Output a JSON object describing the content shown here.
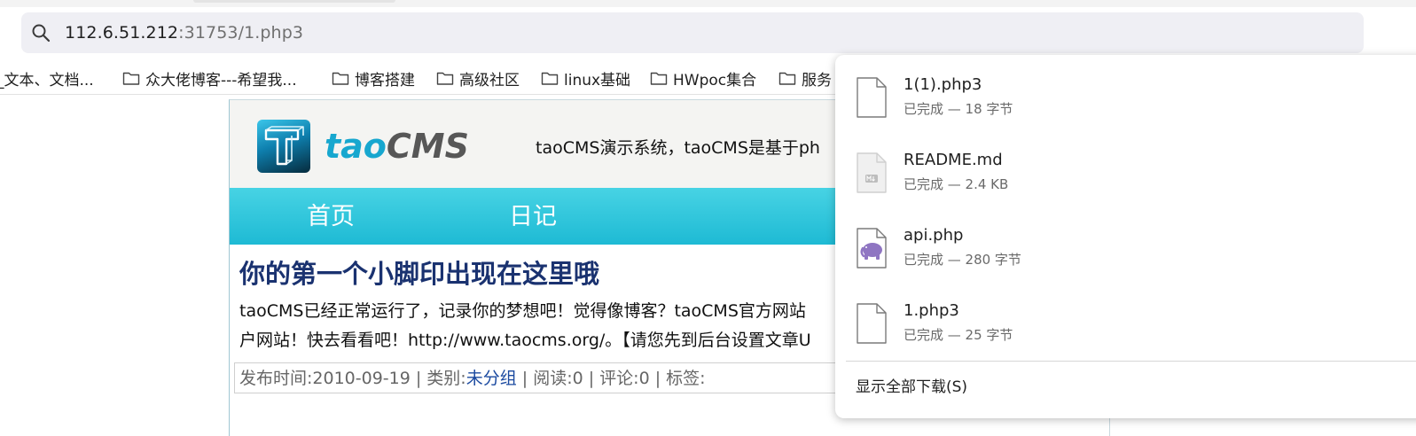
{
  "browser": {
    "address_host": "112.6.51.212",
    "address_rest": ":31753/1.php3"
  },
  "bookmarks": [
    {
      "label": "_文本、文档..."
    },
    {
      "label": "众大佬博客---希望我..."
    },
    {
      "label": "博客搭建"
    },
    {
      "label": "高级社区"
    },
    {
      "label": "linux基础"
    },
    {
      "label": "HWpoc集合"
    },
    {
      "label": "服务"
    }
  ],
  "site": {
    "logo_tao": "tao",
    "logo_cms": "CMS",
    "slogan": "taoCMS演示系统，taoCMS是基于ph",
    "nav": [
      "首页",
      "日记"
    ]
  },
  "post": {
    "title": "你的第一个小脚印出现在这里哦",
    "body_line1": "taoCMS已经正常运行了，记录你的梦想吧！觉得像博客？taoCMS官方网站",
    "body_line2": "户网站！快去看看吧！http://www.taocms.org/。【请您先到后台设置文章U",
    "meta_pre": "发布时间:2010-09-19 | 类别:",
    "meta_category": "未分组",
    "meta_post": " | 阅读:0 | 评论:0 | 标签:"
  },
  "downloads": {
    "items": [
      {
        "name": "1(1).php3",
        "status": "已完成 — 18 字节",
        "icon": "file-icon"
      },
      {
        "name": "README.md",
        "status": "已完成 — 2.4 KB",
        "icon": "markdown-file-icon"
      },
      {
        "name": "api.php",
        "status": "已完成 — 280 字节",
        "icon": "php-elephant-icon"
      },
      {
        "name": "1.php3",
        "status": "已完成 — 25 字节",
        "icon": "file-icon"
      }
    ],
    "show_all": "显示全部下载(S)"
  },
  "colors": {
    "nav_bar": "#2cc4da",
    "post_title": "#1a3270",
    "logo_accent": "#17a7cf"
  }
}
